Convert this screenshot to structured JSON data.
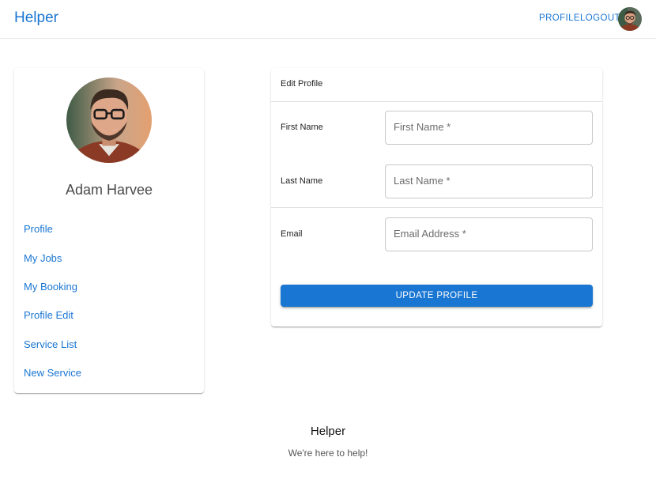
{
  "appbar": {
    "brand": "Helper",
    "nav": {
      "profile": "PROFILE",
      "logout": "LOGOUT"
    },
    "avatar_icon": "user-avatar"
  },
  "sidebar": {
    "avatar_icon": "user-avatar",
    "user_name": "Adam Harvee",
    "items": [
      {
        "label": "Profile"
      },
      {
        "label": "My Jobs"
      },
      {
        "label": "My Booking"
      },
      {
        "label": "Profile Edit"
      },
      {
        "label": "Service List"
      },
      {
        "label": "New Service"
      }
    ]
  },
  "edit_form": {
    "header": "Edit Profile",
    "first_name": {
      "label": "First Name",
      "placeholder": "First Name *"
    },
    "last_name": {
      "label": "Last Name",
      "placeholder": "Last Name *"
    },
    "email": {
      "label": "Email",
      "placeholder": "Email Address *"
    },
    "submit_label": "UPDATE PROFILE"
  },
  "footer": {
    "title": "Helper",
    "tagline": "We're here to help!"
  },
  "colors": {
    "primary": "#1976d2",
    "text": "#212121",
    "muted": "#555555"
  }
}
